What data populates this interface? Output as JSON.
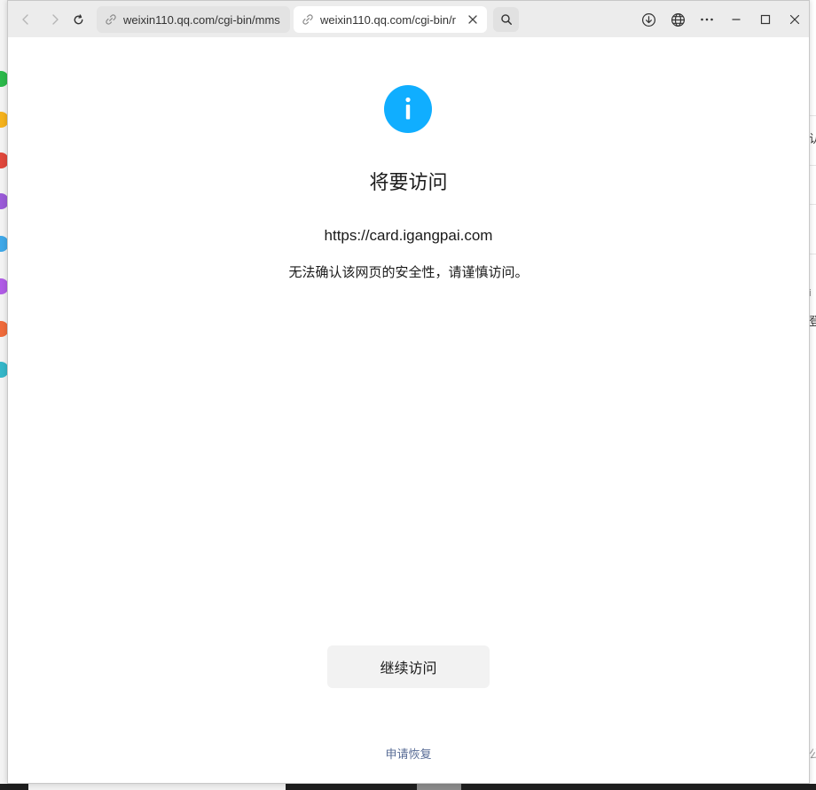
{
  "browser": {
    "tabs": [
      {
        "title": "weixin110.qq.com/cgi-bin/mms",
        "icon": "link-icon",
        "active": false
      },
      {
        "title": "weixin110.qq.com/cgi-bin/r",
        "icon": "link-icon",
        "active": true
      }
    ],
    "toolbar_icons": [
      "back-arrow-icon",
      "forward-arrow-icon",
      "reload-icon",
      "search-icon",
      "download-icon",
      "globe-icon",
      "more-icon",
      "minimize-icon",
      "maximize-icon",
      "close-icon"
    ]
  },
  "page": {
    "icon": "info-icon",
    "icon_color": "#10aeff",
    "heading": "将要访问",
    "url": "https://card.igangpai.com",
    "warning": "无法确认该网页的安全性，请谨慎访问。",
    "continue_label": "继续访问",
    "appeal_label": "申请恢复",
    "link_color": "#576b95"
  },
  "background": {
    "right_fragments": [
      "认",
      "i",
      "登",
      "公"
    ]
  }
}
